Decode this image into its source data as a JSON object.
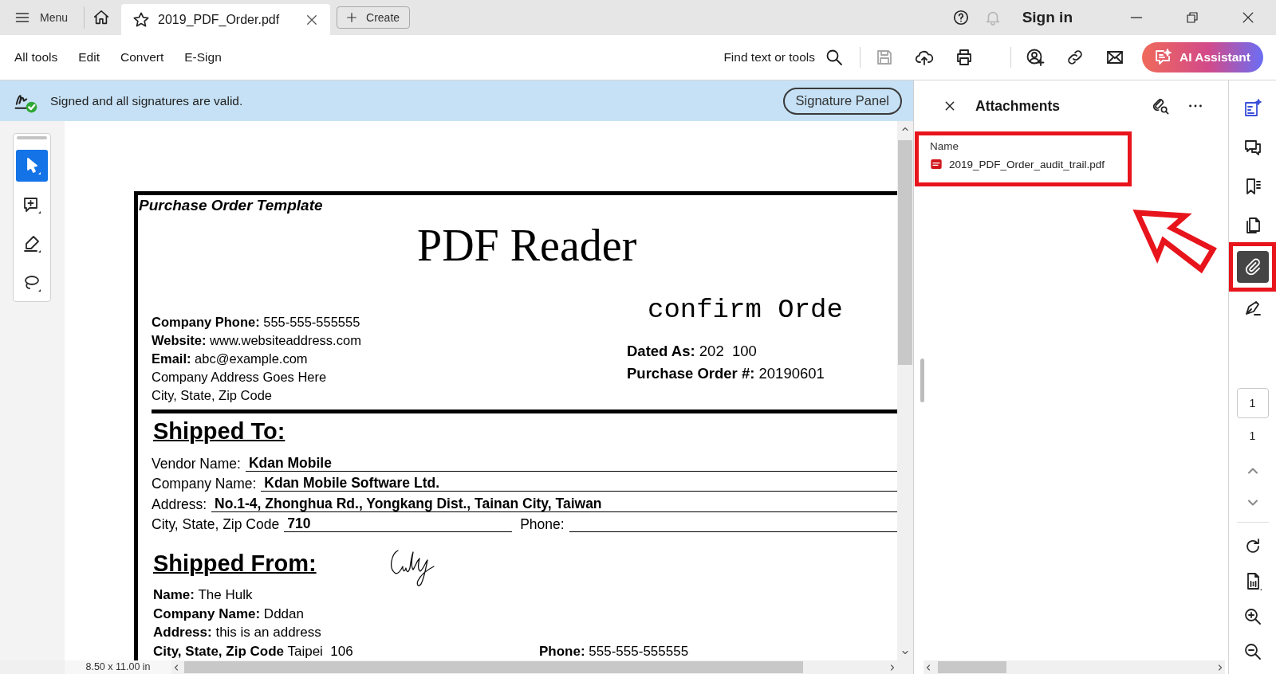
{
  "tab_bar": {
    "menu_label": "Menu",
    "tabs": [
      {
        "title": "2019_PDF_Order.pdf",
        "selected": true
      }
    ],
    "create_label": "Create",
    "sign_in_label": "Sign in"
  },
  "toolbar": {
    "menus": [
      "All tools",
      "Edit",
      "Convert",
      "E-Sign"
    ],
    "search_label": "Find text or tools",
    "actions": [
      {
        "kind": "save",
        "disabled": true
      },
      {
        "kind": "upload",
        "disabled": false
      },
      {
        "kind": "print",
        "disabled": false
      },
      {
        "kind": "share",
        "disabled": false
      },
      {
        "kind": "link",
        "disabled": false
      },
      {
        "kind": "mail",
        "disabled": false
      }
    ],
    "ai_button": "AI Assistant"
  },
  "signature_banner": {
    "message": "Signed and all signatures are valid.",
    "button": "Signature Panel"
  },
  "tools": [
    {
      "kind": "select",
      "selected": true
    },
    {
      "kind": "comment",
      "selected": false
    },
    {
      "kind": "highlight",
      "selected": false
    },
    {
      "kind": "lasso",
      "selected": false
    }
  ],
  "document": {
    "header": "Purchase Order Template",
    "title": "PDF Reader",
    "company_info": [
      "**Company Phone:** 555-555-555555",
      "**Website:** www.websiteaddress.com",
      "**Email:** abc@example.com",
      "Company Address Goes Here",
      "City, State, Zip Code"
    ],
    "confirm_heading": "confirm Orde",
    "order_info": [
      "**Dated As:** 202  100",
      "**Purchase Order #:** 20190601"
    ],
    "shipped_to": {
      "heading": "Shipped To:",
      "fields": [
        {
          "label": "Vendor Name:",
          "value": "Kdan Mobile"
        },
        {
          "label": "Company Name:",
          "value": "Kdan Mobile Software Ltd."
        },
        {
          "label": "Address:",
          "value": "No.1-4, Zhonghua Rd., Yongkang Dist., Tainan City, Taiwan"
        }
      ],
      "city_label": "City, State, Zip Code",
      "city_value": "710",
      "phone_label": "Phone:"
    },
    "shipped_from": {
      "heading": "Shipped From:",
      "lines": [
        "**Name:** The Hulk",
        "**Company Name:** Dddan",
        "**Address:** this is an address",
        "**City, State, Zip Code** Taipei  106"
      ],
      "phone": "**Phone:** 555-555-555555"
    }
  },
  "status_bar": {
    "page_size": "8.50 x 11.00 in"
  },
  "attachments_panel": {
    "title": "Attachments",
    "column": "Name",
    "files": [
      {
        "name": "2019_PDF_Order_audit_trail.pdf",
        "highlighted": true
      }
    ]
  },
  "right_rail": {
    "tools": [
      {
        "kind": "edit",
        "selected": false,
        "highlighted": false
      },
      {
        "kind": "comment",
        "selected": false,
        "highlighted": false
      },
      {
        "kind": "bookmark",
        "selected": false,
        "highlighted": false
      },
      {
        "kind": "pages",
        "selected": false,
        "highlighted": false
      },
      {
        "kind": "attach",
        "selected": true,
        "highlighted": true
      },
      {
        "kind": "sign",
        "selected": false,
        "highlighted": false
      }
    ],
    "page_input": "1",
    "page_count": "1"
  }
}
